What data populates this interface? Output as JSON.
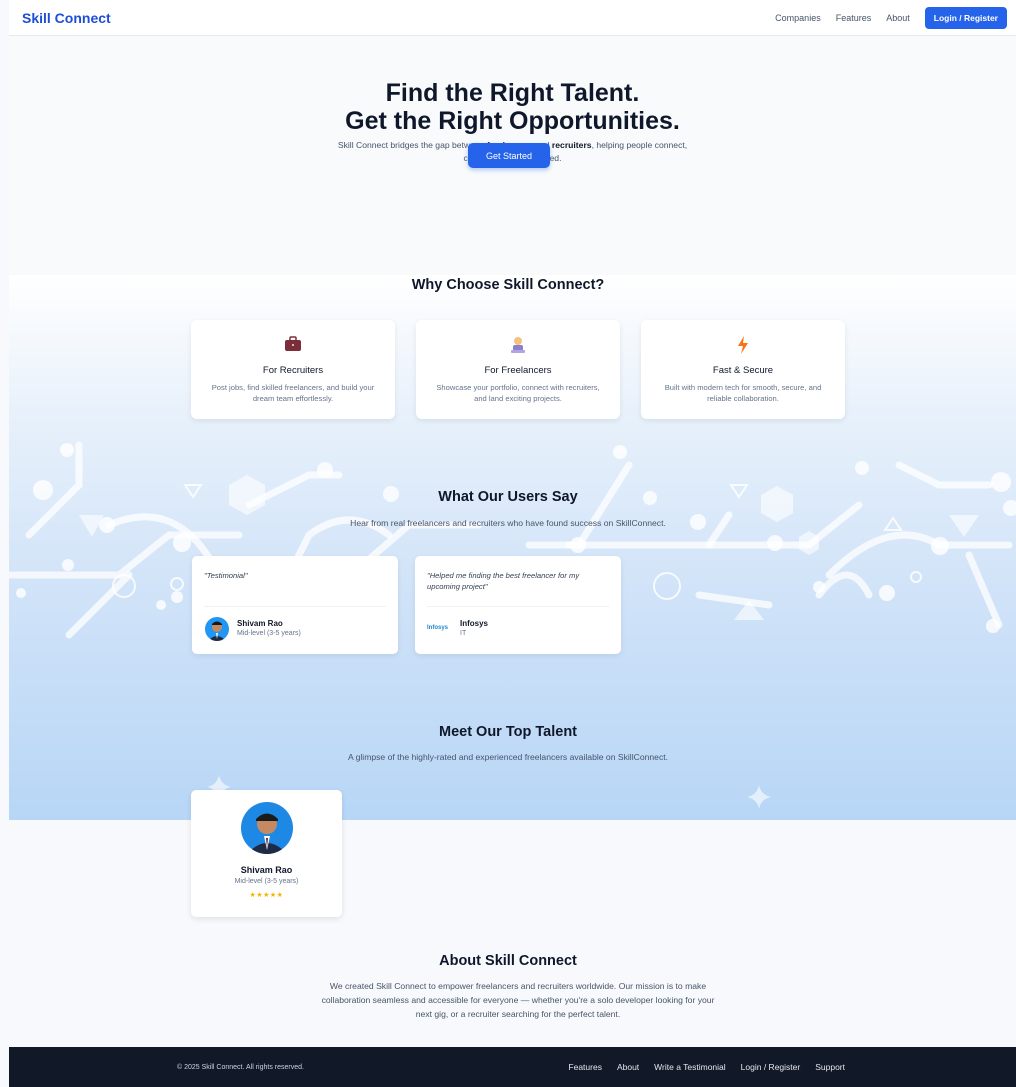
{
  "nav": {
    "brand": "Skill Connect",
    "links": [
      "Companies",
      "Features",
      "About"
    ],
    "login": "Login / Register"
  },
  "hero": {
    "title_line1": "Find the Right Talent.",
    "title_line2": "Get the Right Opportunities.",
    "sub_prefix": "Skill Connect bridges the gap between ",
    "sub_freelancers": "freelancers",
    "sub_and": " and ",
    "sub_recruiters": "recruiters",
    "sub_suffix": ", helping people connect, collaborate, and succeed.",
    "cta": "Get Started"
  },
  "why": {
    "title": "Why Choose Skill Connect?",
    "cards": [
      {
        "icon": "briefcase-icon",
        "title": "For Recruiters",
        "desc": "Post jobs, find skilled freelancers, and build your dream team effortlessly."
      },
      {
        "icon": "freelancer-laptop-icon",
        "title": "For Freelancers",
        "desc": "Showcase your portfolio, connect with recruiters, and land exciting projects."
      },
      {
        "icon": "lightning-icon",
        "title": "Fast & Secure",
        "desc": "Built with modern tech for smooth, secure, and reliable collaboration."
      }
    ]
  },
  "testimonials": {
    "title": "What Our Users Say",
    "subtitle": "Hear from real freelancers and recruiters who have found success on SkillConnect.",
    "items": [
      {
        "quote": "\"Testimonial\"",
        "name": "Shivam Rao",
        "role": "Mid-level (3-5 years)"
      },
      {
        "quote": "\"Helped me finding the best freelancer for my upcoming project\"",
        "name": "Infosys",
        "role": "IT",
        "logo": "Infosys"
      }
    ]
  },
  "talent": {
    "title": "Meet Our Top Talent",
    "subtitle": "A glimpse of the highly-rated and experienced freelancers available on SkillConnect.",
    "people": [
      {
        "name": "Shivam Rao",
        "role": "Mid-level (3-5 years)",
        "stars": "★★★★★"
      }
    ]
  },
  "about": {
    "title": "About Skill Connect",
    "text": "We created Skill Connect to empower freelancers and recruiters worldwide. Our mission is to make collaboration seamless and accessible for everyone — whether you're a solo developer looking for your next gig, or a recruiter searching for the perfect talent."
  },
  "footer": {
    "copyright": "© 2025 Skill Connect. All rights reserved.",
    "links": [
      "Features",
      "About",
      "Write a Testimonial",
      "Login / Register",
      "Support"
    ]
  },
  "colors": {
    "brand": "#1d4ed8",
    "primary_button": "#2563eb",
    "footer_bg": "#111827",
    "star": "#f5b301"
  }
}
